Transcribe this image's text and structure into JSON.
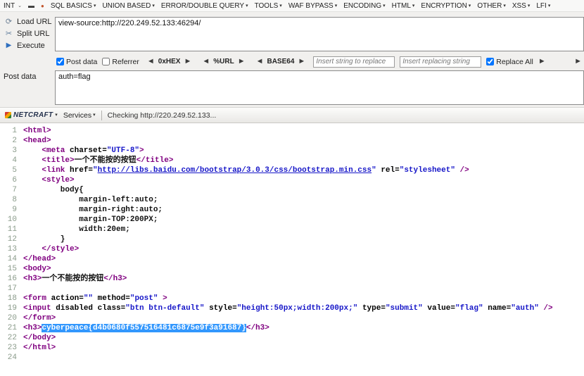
{
  "icons": {
    "caret": "▾",
    "chevron": "⌄",
    "dash": "▬",
    "dot": "●",
    "load_url": "⟳",
    "split_url": "✂",
    "execute": "▶",
    "arrow_left": "◄",
    "arrow_right": "►"
  },
  "menubar": {
    "int_label": "INT",
    "items": [
      "SQL BASICS",
      "UNION BASED",
      "ERROR/DOUBLE QUERY",
      "TOOLS",
      "WAF BYPASS",
      "ENCODING",
      "HTML",
      "ENCRYPTION",
      "OTHER",
      "XSS",
      "LFI"
    ]
  },
  "sidebar": {
    "load_url": "Load URL",
    "split_url": "Split URL",
    "execute": "Execute"
  },
  "url_box": {
    "value": "view-source:http://220.249.52.133:46294/"
  },
  "options": {
    "post_data": "Post data",
    "referrer": "Referrer",
    "encoders": [
      "0xHEX",
      "%URL",
      "BASE64"
    ],
    "replace_from_placeholder": "Insert string to replace",
    "replace_to_placeholder": "Insert replacing string",
    "replace_all": "Replace All"
  },
  "post_data": {
    "label": "Post data",
    "value": "auth=flag"
  },
  "netcraft": {
    "logo": "NETCRAFT",
    "services": "Services",
    "status": "Checking http://220.249.52.133..."
  },
  "source": {
    "lines": [
      {
        "n": 1,
        "s": [
          {
            "t": "g",
            "v": "<html>"
          }
        ]
      },
      {
        "n": 2,
        "s": [
          {
            "t": "g",
            "v": "<head>"
          }
        ]
      },
      {
        "n": 3,
        "s": [
          {
            "t": "p",
            "v": "    "
          },
          {
            "t": "g",
            "v": "<meta "
          },
          {
            "t": "a",
            "v": "charset="
          },
          {
            "t": "v",
            "v": "\"UTF-8\""
          },
          {
            "t": "g",
            "v": ">"
          }
        ]
      },
      {
        "n": 4,
        "s": [
          {
            "t": "p",
            "v": "    "
          },
          {
            "t": "g",
            "v": "<title>"
          },
          {
            "t": "x",
            "v": "一个不能按的按钮"
          },
          {
            "t": "g",
            "v": "</title>"
          }
        ]
      },
      {
        "n": 5,
        "s": [
          {
            "t": "p",
            "v": "    "
          },
          {
            "t": "g",
            "v": "<link "
          },
          {
            "t": "a",
            "v": "href="
          },
          {
            "t": "v",
            "v": "\""
          },
          {
            "t": "l",
            "v": "http://libs.baidu.com/bootstrap/3.0.3/css/bootstrap.min.css"
          },
          {
            "t": "v",
            "v": "\""
          },
          {
            "t": "p",
            "v": " "
          },
          {
            "t": "a",
            "v": "rel="
          },
          {
            "t": "v",
            "v": "\"stylesheet\""
          },
          {
            "t": "g",
            "v": " />"
          }
        ]
      },
      {
        "n": 6,
        "s": [
          {
            "t": "p",
            "v": "    "
          },
          {
            "t": "g",
            "v": "<style>"
          }
        ]
      },
      {
        "n": 7,
        "s": [
          {
            "t": "x",
            "v": "        body{"
          }
        ]
      },
      {
        "n": 8,
        "s": [
          {
            "t": "x",
            "v": "            margin-left:auto;"
          }
        ]
      },
      {
        "n": 9,
        "s": [
          {
            "t": "x",
            "v": "            margin-right:auto;"
          }
        ]
      },
      {
        "n": 10,
        "s": [
          {
            "t": "x",
            "v": "            margin-TOP:200PX;"
          }
        ]
      },
      {
        "n": 11,
        "s": [
          {
            "t": "x",
            "v": "            width:20em;"
          }
        ]
      },
      {
        "n": 12,
        "s": [
          {
            "t": "x",
            "v": "        }"
          }
        ]
      },
      {
        "n": 13,
        "s": [
          {
            "t": "p",
            "v": "    "
          },
          {
            "t": "g",
            "v": "</style>"
          }
        ]
      },
      {
        "n": 14,
        "s": [
          {
            "t": "g",
            "v": "</head>"
          }
        ]
      },
      {
        "n": 15,
        "s": [
          {
            "t": "g",
            "v": "<body>"
          }
        ]
      },
      {
        "n": 16,
        "s": [
          {
            "t": "g",
            "v": "<h3>"
          },
          {
            "t": "x",
            "v": "一个不能按的按钮"
          },
          {
            "t": "g",
            "v": "</h3>"
          }
        ]
      },
      {
        "n": 17,
        "s": []
      },
      {
        "n": 18,
        "s": [
          {
            "t": "g",
            "v": "<form "
          },
          {
            "t": "a",
            "v": "action="
          },
          {
            "t": "v",
            "v": "\"\""
          },
          {
            "t": "p",
            "v": " "
          },
          {
            "t": "a",
            "v": "method="
          },
          {
            "t": "v",
            "v": "\"post\""
          },
          {
            "t": "g",
            "v": " >"
          }
        ]
      },
      {
        "n": 19,
        "s": [
          {
            "t": "g",
            "v": "<input "
          },
          {
            "t": "a",
            "v": "disabled "
          },
          {
            "t": "a",
            "v": "class="
          },
          {
            "t": "v",
            "v": "\"btn btn-default\""
          },
          {
            "t": "p",
            "v": " "
          },
          {
            "t": "a",
            "v": "style="
          },
          {
            "t": "v",
            "v": "\"height:50px;width:200px;\""
          },
          {
            "t": "p",
            "v": " "
          },
          {
            "t": "a",
            "v": "type="
          },
          {
            "t": "v",
            "v": "\"submit\""
          },
          {
            "t": "p",
            "v": " "
          },
          {
            "t": "a",
            "v": "value="
          },
          {
            "t": "v",
            "v": "\"flag\""
          },
          {
            "t": "p",
            "v": " "
          },
          {
            "t": "a",
            "v": "name="
          },
          {
            "t": "v",
            "v": "\"auth\""
          },
          {
            "t": "g",
            "v": " />"
          }
        ]
      },
      {
        "n": 20,
        "s": [
          {
            "t": "g",
            "v": "</form>"
          }
        ]
      },
      {
        "n": 21,
        "s": [
          {
            "t": "g",
            "v": "<h3>"
          },
          {
            "t": "f",
            "v": "cyberpeace{d4b0680f557516481c6875e9f3a91687}"
          },
          {
            "t": "g",
            "v": "</h3>"
          }
        ]
      },
      {
        "n": 22,
        "s": [
          {
            "t": "g",
            "v": "</body>"
          }
        ]
      },
      {
        "n": 23,
        "s": [
          {
            "t": "g",
            "v": "</html>"
          }
        ]
      },
      {
        "n": 24,
        "s": []
      }
    ]
  }
}
